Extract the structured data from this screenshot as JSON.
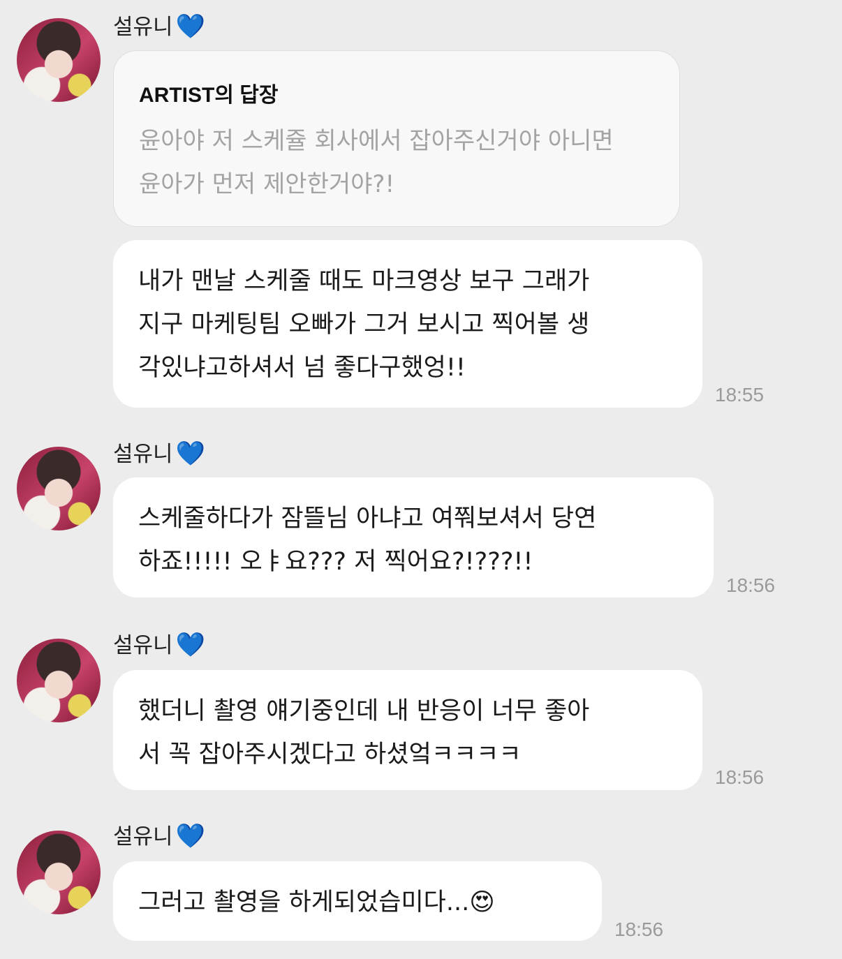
{
  "sender": {
    "name": "설유니",
    "heart": "💙"
  },
  "reply": {
    "title": "ARTIST의 답장",
    "lines": [
      "윤아야 저 스케쥴 회사에서 잡아주신거야 아니면",
      "윤아가 먼저 제안한거야?!"
    ]
  },
  "messages": [
    {
      "lines": [
        "내가 맨날 스케줄 때도 마크영상 보구 그래가",
        "지구 마케팅팀 오빠가 그거 보시고 찍어볼 생",
        "각있냐고하셔서 넘 좋다구했엉!!"
      ],
      "time": "18:55"
    },
    {
      "lines": [
        "스케줄하다가 잠뜰님 아냐고 여쭤보셔서 당연",
        "하죠!!!!! 오ㅑ요??? 저 찍어요?!???!!"
      ],
      "time": "18:56"
    },
    {
      "lines": [
        "했더니 촬영 얘기중인데 내 반응이 너무 좋아",
        "서 꼭 잡아주시겠다고 하셨엌ㅋㅋㅋㅋ"
      ],
      "time": "18:56"
    },
    {
      "lines": [
        "그러고 촬영을 하게되었습미다...😍"
      ],
      "time": "18:56"
    }
  ]
}
